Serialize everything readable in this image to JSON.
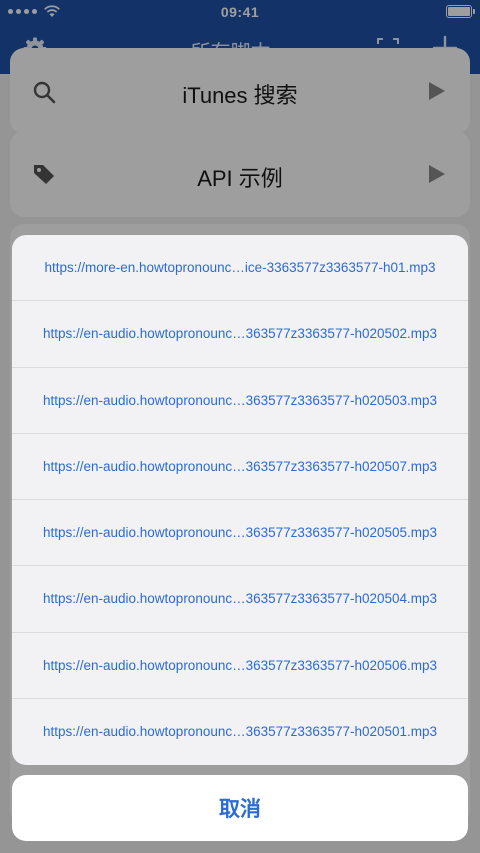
{
  "status_bar": {
    "time": "09:41"
  },
  "nav": {
    "title": "所有脚本",
    "caret": "▼"
  },
  "background_list": {
    "items": [
      {
        "label": "iTunes 搜索"
      },
      {
        "label": "API 示例"
      }
    ]
  },
  "action_sheet": {
    "items": [
      "https://more-en.howtopronounc…ice-3363577z3363577-h01.mp3",
      "https://en-audio.howtopronounc…363577z3363577-h020502.mp3",
      "https://en-audio.howtopronounc…363577z3363577-h020503.mp3",
      "https://en-audio.howtopronounc…363577z3363577-h020507.mp3",
      "https://en-audio.howtopronounc…363577z3363577-h020505.mp3",
      "https://en-audio.howtopronounc…363577z3363577-h020504.mp3",
      "https://en-audio.howtopronounc…363577z3363577-h020506.mp3",
      "https://en-audio.howtopronounc…363577z3363577-h020501.mp3"
    ],
    "cancel_label": "取消"
  },
  "colors": {
    "nav_background": "#1f52a8",
    "link_blue": "#2b6bd6",
    "overlay": "rgba(0,0,0,0.38)"
  }
}
